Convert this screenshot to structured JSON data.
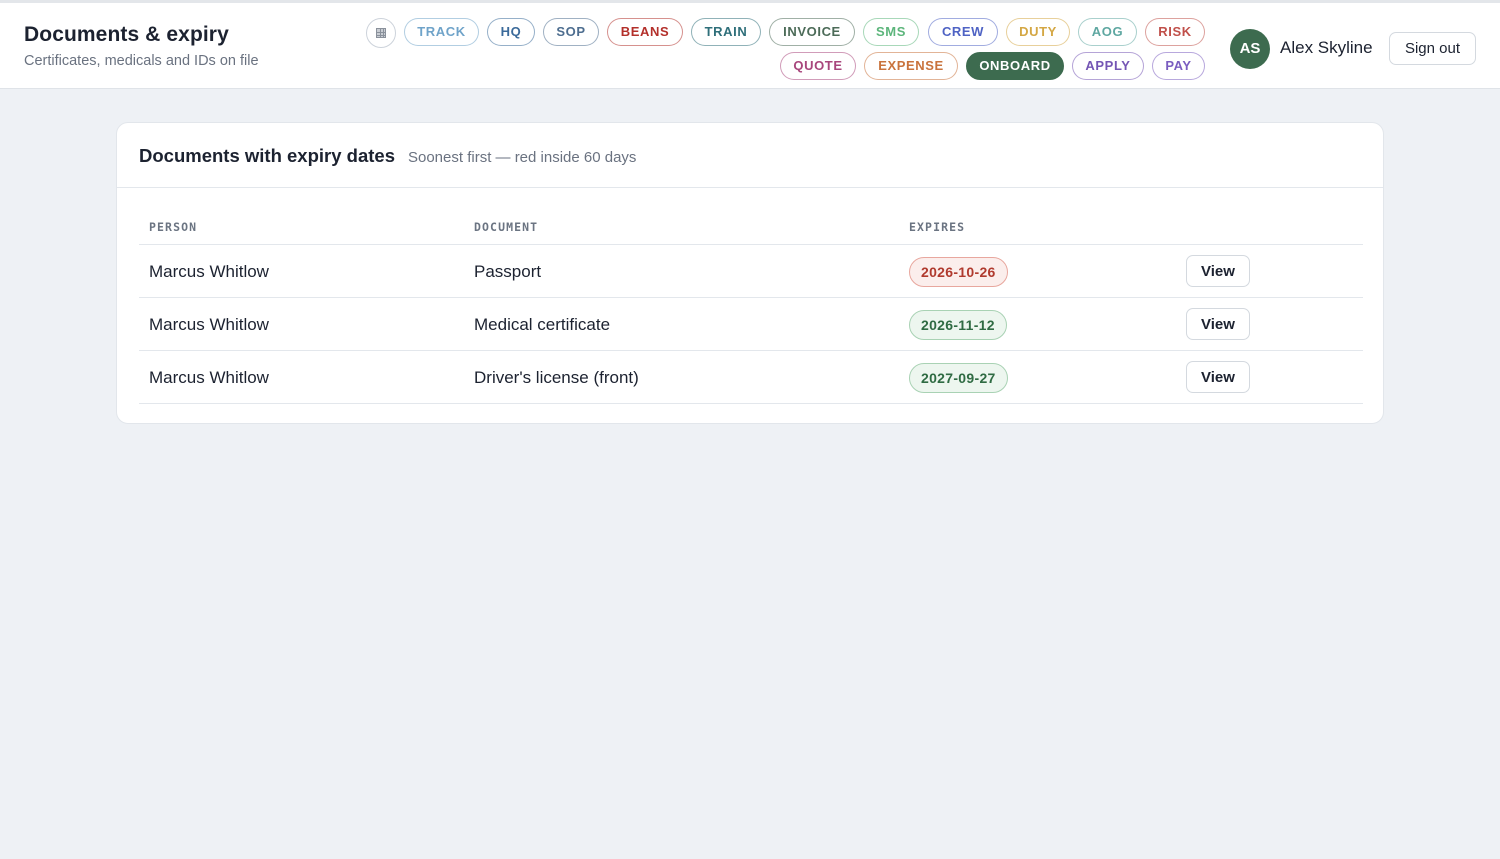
{
  "header": {
    "title": "Documents & expiry",
    "subtitle": "Certificates, medicals and IDs on file"
  },
  "nav": {
    "grid_icon": "grid-icon",
    "row1": [
      {
        "label": "TRACK",
        "color": "#6fa3c9"
      },
      {
        "label": "HQ",
        "color": "#3b6a9a"
      },
      {
        "label": "SOP",
        "color": "#4d6d8f"
      },
      {
        "label": "BEANS",
        "color": "#b3302b"
      },
      {
        "label": "TRAIN",
        "color": "#2f6f7a"
      },
      {
        "label": "INVOICE",
        "color": "#4c6b58"
      },
      {
        "label": "SMS",
        "color": "#5cb57b"
      },
      {
        "label": "CREW",
        "color": "#4f63c4"
      },
      {
        "label": "DUTY",
        "color": "#d4a744"
      },
      {
        "label": "AOG",
        "color": "#5ea7a1"
      },
      {
        "label": "RISK",
        "color": "#c0504a"
      }
    ],
    "row2": [
      {
        "label": "QUOTE",
        "color": "#a8467c"
      },
      {
        "label": "EXPENSE",
        "color": "#c9733c"
      },
      {
        "label": "ONBOARD",
        "color": "#3d6b4f",
        "active": true
      },
      {
        "label": "APPLY",
        "color": "#7455b4"
      },
      {
        "label": "PAY",
        "color": "#7a5cc0"
      }
    ]
  },
  "user": {
    "initials": "AS",
    "name": "Alex Skyline",
    "signout_label": "Sign out",
    "avatar_color": "#3d6b4f"
  },
  "card": {
    "title": "Documents with expiry dates",
    "subtitle": "Soonest first — red inside 60 days"
  },
  "table": {
    "headers": {
      "person": "PERSON",
      "document": "DOCUMENT",
      "expires": "EXPIRES"
    },
    "rows": [
      {
        "person": "Marcus Whitlow",
        "document": "Passport",
        "expires": "2026-10-26",
        "status": "warn",
        "action": "View"
      },
      {
        "person": "Marcus Whitlow",
        "document": "Medical certificate",
        "expires": "2026-11-12",
        "status": "ok",
        "action": "View"
      },
      {
        "person": "Marcus Whitlow",
        "document": "Driver's license (front)",
        "expires": "2027-09-27",
        "status": "ok",
        "action": "View"
      }
    ]
  },
  "colors": {
    "page_bg": "#eef1f5",
    "expiring_soon": "#b03a2e",
    "valid": "#2f6b43"
  }
}
